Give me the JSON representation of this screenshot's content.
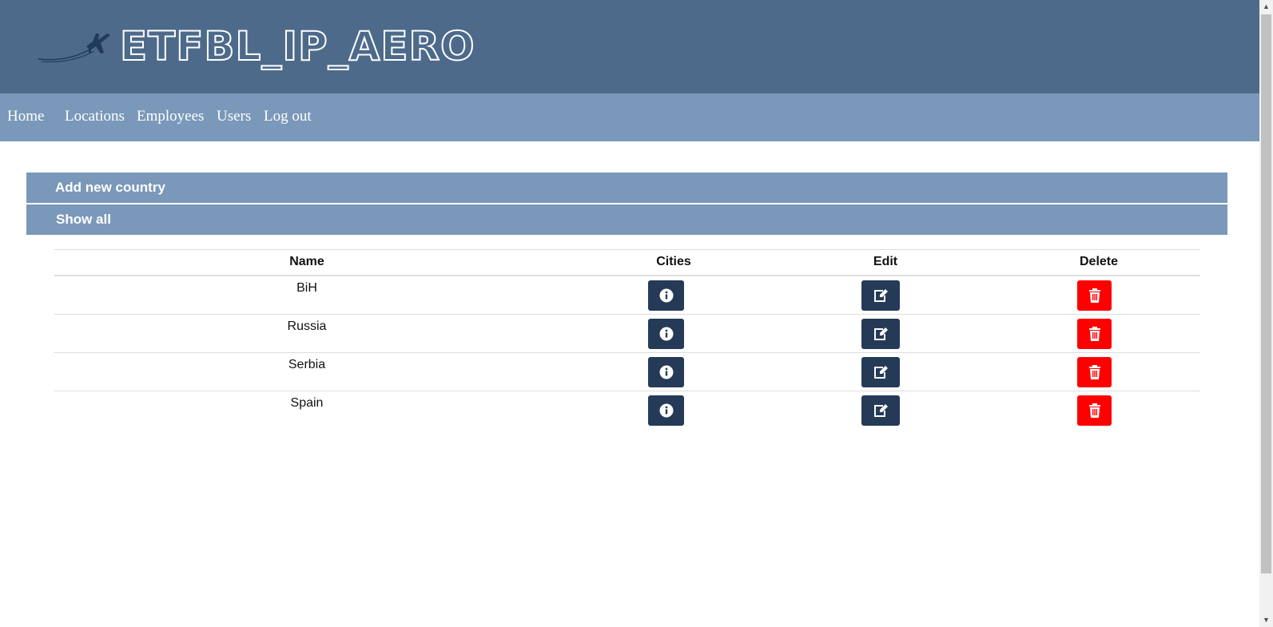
{
  "logo": {
    "text": "ETFBL_IP_AERO",
    "icon": "airplane-icon"
  },
  "nav": {
    "items": [
      {
        "label": "Home"
      },
      {
        "label": "Locations"
      },
      {
        "label": "Employees"
      },
      {
        "label": "Users"
      },
      {
        "label": "Log out"
      }
    ]
  },
  "accordion": {
    "add_label": "Add new country",
    "show_label": "Show all"
  },
  "table": {
    "headers": {
      "name": "Name",
      "cities": "Cities",
      "edit": "Edit",
      "delete": "Delete"
    },
    "rows": [
      {
        "name": "BiH"
      },
      {
        "name": "Russia"
      },
      {
        "name": "Serbia"
      },
      {
        "name": "Spain"
      }
    ]
  },
  "icons": {
    "cities": "info-icon",
    "edit": "edit-icon",
    "delete": "trash-icon"
  },
  "colors": {
    "header_bg": "#4d6a8a",
    "nav_bg": "#7a98b9",
    "button_dark": "#253a57",
    "button_delete": "#ff0000"
  }
}
